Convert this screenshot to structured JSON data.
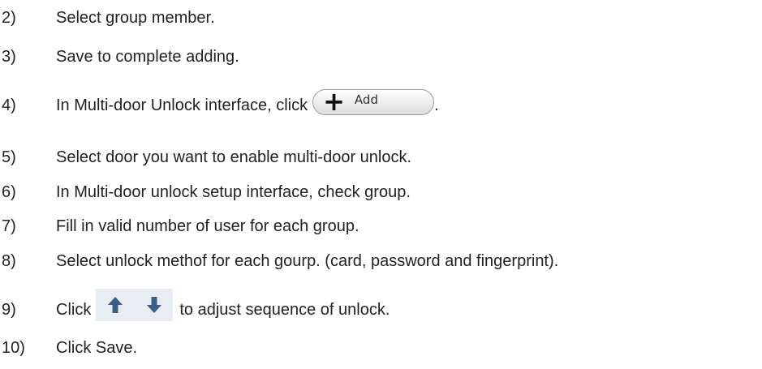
{
  "steps": [
    {
      "num": "2)",
      "text": "Select group member."
    },
    {
      "num": "3)",
      "text": "Save to complete adding."
    },
    {
      "num": "4)",
      "text_before": "In Multi-door Unlock interface, click",
      "text_after": "."
    },
    {
      "num": "5)",
      "text": "Select door you want to enable multi-door unlock."
    },
    {
      "num": "6)",
      "text": "In Multi-door unlock setup interface, check group."
    },
    {
      "num": "7)",
      "text": "Fill in valid number of user for each group."
    },
    {
      "num": "8)",
      "text": "Select unlock methof for each gourp. (card, password and fingerprint)."
    },
    {
      "num": "9)",
      "text_before": "Click",
      "text_after": "to adjust sequence of unlock."
    },
    {
      "num": "10)",
      "text": "Click Save."
    }
  ],
  "add_button": {
    "plus": "+",
    "label": "Add",
    "icon": "plus-icon"
  },
  "arrow_buttons": {
    "up_icon": "arrow-up-icon",
    "down_icon": "arrow-down-icon",
    "color": "#3c5e86"
  }
}
